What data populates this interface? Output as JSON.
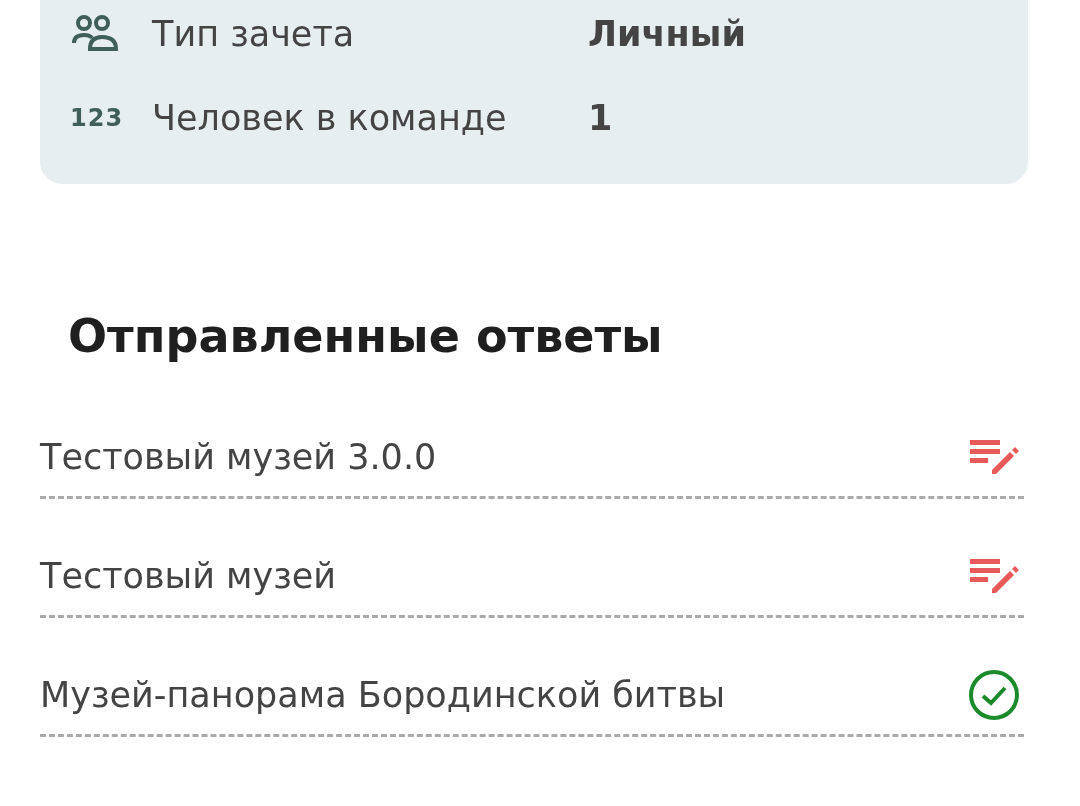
{
  "info": [
    {
      "kind": "people",
      "label": "Тип зачета",
      "value": "Личный"
    },
    {
      "kind": "number",
      "icon_text": "123",
      "label": "Человек в команде",
      "value": "1"
    }
  ],
  "section_title": "Отправленные ответы",
  "answers": [
    {
      "name": "Тестовый музей 3.0.0",
      "kind": "edit"
    },
    {
      "name": "Тестовый музей",
      "kind": "edit"
    },
    {
      "name": "Музей-панорама Бородинской битвы",
      "kind": "done"
    }
  ]
}
